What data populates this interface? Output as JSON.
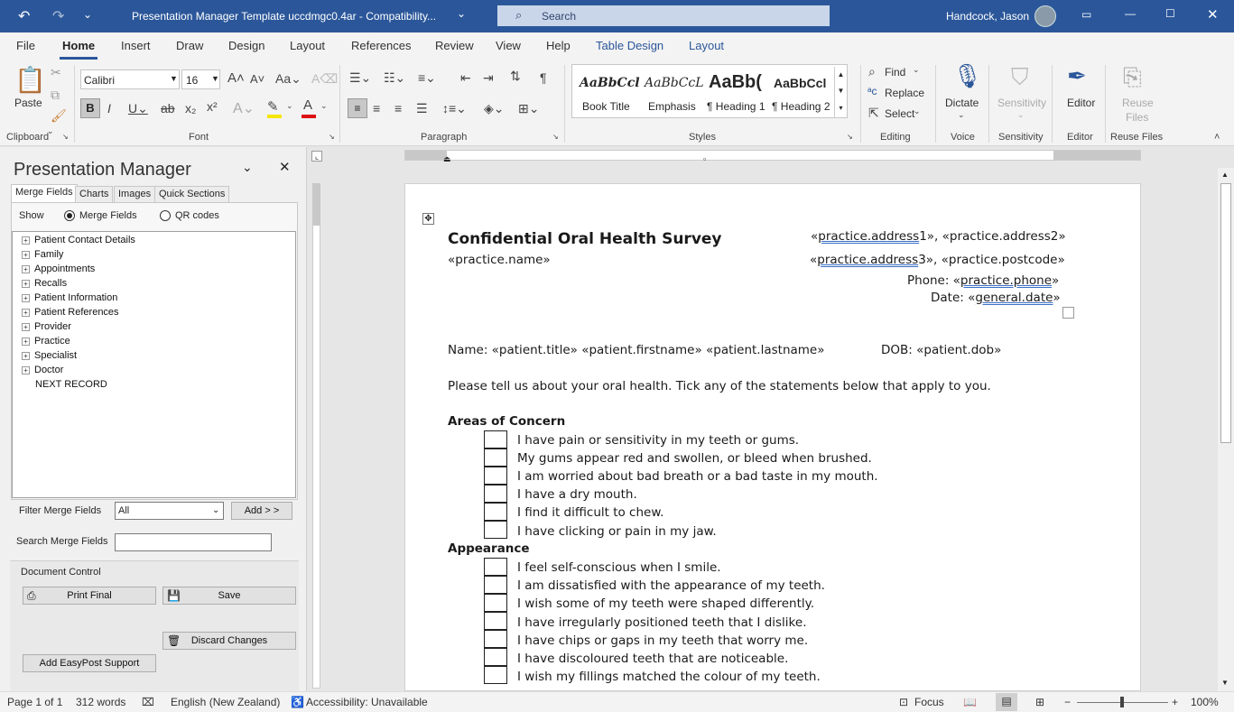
{
  "window": {
    "title": "Presentation Manager Template uccdmgc0.4ar  -  Compatibility...",
    "search_placeholder": "Search",
    "user": "Handcock, Jason"
  },
  "tabs": [
    "File",
    "Home",
    "Insert",
    "Draw",
    "Design",
    "Layout",
    "References",
    "Review",
    "View",
    "Help",
    "Table Design",
    "Layout"
  ],
  "ribbon": {
    "clipboard": {
      "paste": "Paste",
      "group": "Clipboard"
    },
    "font": {
      "name": "Calibri",
      "size": "16",
      "group": "Font"
    },
    "paragraph": {
      "group": "Paragraph"
    },
    "styles": {
      "items": [
        {
          "preview": "AaBbCcl",
          "label": "Book Title"
        },
        {
          "preview": "AaBbCcL",
          "label": "Emphasis"
        },
        {
          "preview": "AaBb(",
          "label": "¶ Heading 1"
        },
        {
          "preview": "AaBbCcl",
          "label": "¶ Heading 2"
        }
      ],
      "group": "Styles"
    },
    "editing": {
      "find": "Find",
      "replace": "Replace",
      "select": "Select",
      "group": "Editing"
    },
    "voice": {
      "dictate": "Dictate",
      "group": "Voice"
    },
    "sensitivity": {
      "label": "Sensitivity",
      "group": "Sensitivity"
    },
    "editor": {
      "label": "Editor",
      "group": "Editor"
    },
    "reuse": {
      "label1": "Reuse",
      "label2": "Files",
      "group": "Reuse Files"
    }
  },
  "pane": {
    "title": "Presentation Manager",
    "tabs": [
      "Merge Fields",
      "Charts",
      "Images",
      "Quick Sections"
    ],
    "show_label": "Show",
    "radio_merge": "Merge Fields",
    "radio_qr": "QR codes",
    "tree": [
      "Patient Contact Details",
      "Family",
      "Appointments",
      "Recalls",
      "Patient Information",
      "Patient References",
      "Provider",
      "Practice",
      "Specialist",
      "Doctor",
      "NEXT RECORD"
    ],
    "filter_label": "Filter Merge Fields",
    "filter_value": "All",
    "add_button": "Add > >",
    "search_label": "Search Merge Fields",
    "doc_control": "Document Control",
    "print_final": "Print Final",
    "save": "Save",
    "discard": "Discard Changes",
    "easypost": "Add EasyPost Support"
  },
  "document": {
    "title": "Confidential Oral Health Survey",
    "addr1_pre": "«",
    "addr1_field": "practice.address",
    "addr1_post": "1», «practice.address2»",
    "practice_name": "«practice.name»",
    "addr2_pre": "«",
    "addr2_field": "practice.address",
    "addr2_post": "3», «practice.postcode»",
    "phone_pre": "Phone: «",
    "phone_field": "practice.phone",
    "phone_post": "»",
    "date_pre": "Date: «",
    "date_field": "general.date",
    "date_post": "»",
    "name_line": "Name: «patient.title» «patient.firstname» «patient.lastname»",
    "dob_line": "DOB:  «patient.dob»",
    "intro": "Please tell us about your oral health. Tick any of the statements below that apply to you.",
    "section1": "Areas of Concern",
    "items1": [
      "I have pain or sensitivity in my teeth or gums.",
      "My gums appear red and swollen, or bleed when brushed.",
      "I am worried about bad breath or a bad taste in my mouth.",
      "I have a dry mouth.",
      "I find it difficult to chew.",
      "I have clicking or pain in my jaw."
    ],
    "section2": "Appearance",
    "items2": [
      "I feel self-conscious when I smile.",
      "I am dissatisfied with the appearance of my teeth.",
      "I wish some of my teeth were shaped differently.",
      "I have irregularly positioned teeth that I dislike.",
      "I have chips or gaps in my teeth that worry me.",
      "I have discoloured teeth that are noticeable.",
      "I wish my fillings matched the colour of my teeth."
    ]
  },
  "status": {
    "page": "Page 1 of 1",
    "words": "312 words",
    "language": "English (New Zealand)",
    "accessibility": "Accessibility: Unavailable",
    "focus": "Focus",
    "zoom": "100%"
  }
}
